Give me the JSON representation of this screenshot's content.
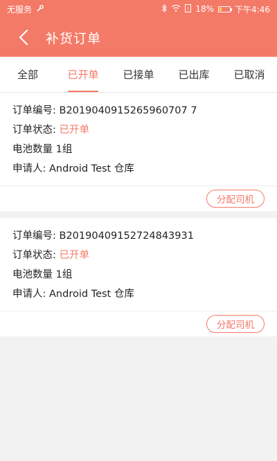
{
  "status_bar": {
    "carrier": "无服务",
    "battery": "18%",
    "battery_level": 0.18,
    "time": "下午4:46"
  },
  "header": {
    "title": "补货订单",
    "back_icon": "chevron-left-icon"
  },
  "tabs": [
    {
      "label": "全部",
      "active": false
    },
    {
      "label": "已开单",
      "active": true
    },
    {
      "label": "已接单",
      "active": false
    },
    {
      "label": "已出库",
      "active": false
    },
    {
      "label": "已取消",
      "active": false
    }
  ],
  "colors": {
    "accent": "#f47a68",
    "background": "#f2f2f2"
  },
  "orders": [
    {
      "order_no_label": "订单编号:",
      "order_no": "B2019040915265960707 7",
      "status_label": "订单状态:",
      "status": "已开单",
      "qty_label": "电池数量",
      "qty": "1组",
      "applicant_label": "申请人:",
      "applicant": "Android Test 仓库",
      "action": "分配司机"
    },
    {
      "order_no_label": "订单编号:",
      "order_no": "B20190409152724843931",
      "status_label": "订单状态:",
      "status": "已开单",
      "qty_label": "电池数量",
      "qty": "1组",
      "applicant_label": "申请人:",
      "applicant": "Android Test 仓库",
      "action": "分配司机"
    }
  ]
}
